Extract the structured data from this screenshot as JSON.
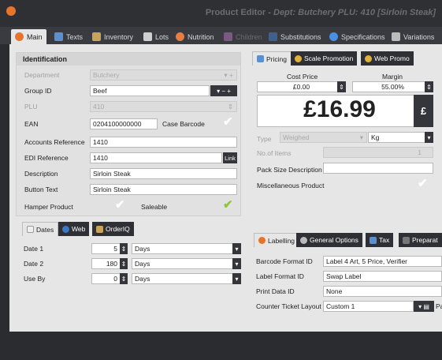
{
  "window": {
    "title_prefix": "Product Editor -",
    "title_detail": "Dept: Butchery  PLU: 410 [Sirloin Steak]"
  },
  "tabs": [
    {
      "label": "Main"
    },
    {
      "label": "Texts"
    },
    {
      "label": "Inventory"
    },
    {
      "label": "Lots"
    },
    {
      "label": "Nutrition"
    },
    {
      "label": "Children"
    },
    {
      "label": "Substitutions"
    },
    {
      "label": "Specifications"
    },
    {
      "label": "Variations"
    }
  ],
  "identification": {
    "header": "Identification",
    "department_label": "Department",
    "department_value": "Butchery",
    "group_label": "Group ID",
    "group_value": "Beef",
    "plu_label": "PLU",
    "plu_value": "410",
    "ean_label": "EAN",
    "ean_value": "0204100000000",
    "case_barcode_label": "Case Barcode",
    "accounts_ref_label": "Accounts Reference",
    "accounts_ref_value": "1410",
    "edi_ref_label": "EDI Reference",
    "edi_ref_value": "1410",
    "link_label": "Link",
    "description_label": "Description",
    "description_value": "Sirloin Steak",
    "button_text_label": "Button Text",
    "button_text_value": "Sirloin Steak",
    "hamper_label": "Hamper Product",
    "saleable_label": "Saleable"
  },
  "pricing": {
    "tabs": [
      {
        "label": "Pricing"
      },
      {
        "label": "Scale Promotion"
      },
      {
        "label": "Web Promo"
      }
    ],
    "cost_price_label": "Cost Price",
    "cost_price_value": "£0.00",
    "margin_label": "Margin",
    "margin_value": "55.00%",
    "price_value": "£16.99",
    "currency_symbol": "£",
    "type_label": "Type",
    "type_value": "Weighed",
    "unit_value": "Kg",
    "items_label": "No.of Items",
    "items_value": "1",
    "pack_size_label": "Pack Size Description",
    "pack_size_value": "",
    "misc_label": "Miscellaneous Product"
  },
  "dates": {
    "tabs": [
      {
        "label": "Dates"
      },
      {
        "label": "Web"
      },
      {
        "label": "OrderIQ"
      }
    ],
    "rows": [
      {
        "label": "Date 1",
        "value": "5",
        "unit": "Days"
      },
      {
        "label": "Date 2",
        "value": "180",
        "unit": "Days"
      },
      {
        "label": "Use By",
        "value": "0",
        "unit": "Days"
      }
    ]
  },
  "labelling": {
    "tabs": [
      {
        "label": "Labelling"
      },
      {
        "label": "General Options"
      },
      {
        "label": "Tax"
      },
      {
        "label": "Preparat"
      }
    ],
    "barcode_format_label": "Barcode Format ID",
    "barcode_format_value": "Label 4 Art, 5 Price, Verifier",
    "label_format_label": "Label Format ID",
    "label_format_value": "Swap Label",
    "print_data_label": "Print Data ID",
    "print_data_value": "None",
    "counter_ticket_label": "Counter Ticket Layout",
    "counter_ticket_value": "Custom 1",
    "partial_label": "Pa"
  },
  "colors": {
    "accent_orange": "#e8732a",
    "check_green": "#8cc63f",
    "dark_bar": "#2f3034"
  }
}
